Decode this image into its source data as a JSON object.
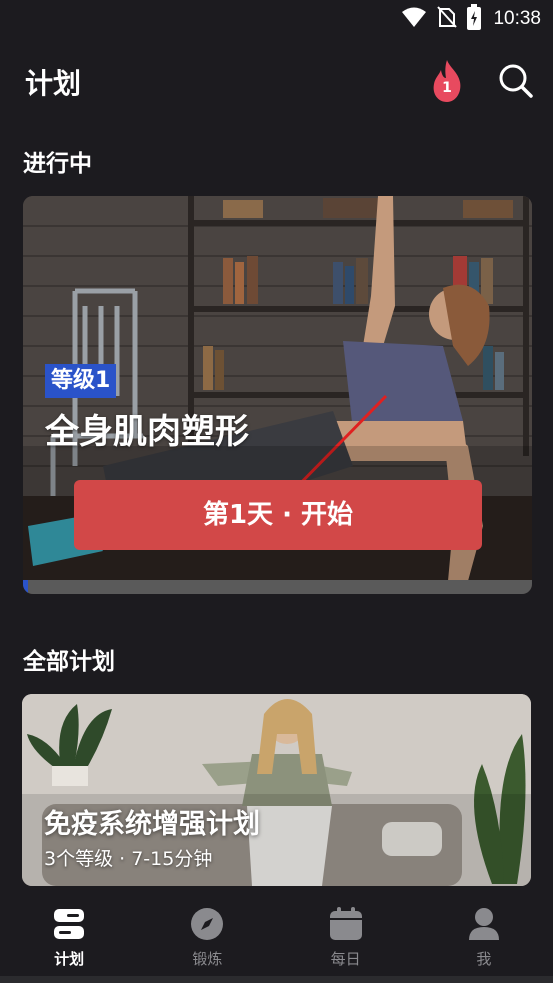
{
  "status_bar": {
    "time": "10:38",
    "icons": [
      "wifi-icon",
      "no-sim-icon",
      "battery-charging-icon"
    ]
  },
  "header": {
    "title": "计划",
    "streak_count": "1",
    "icons": [
      "flame-icon",
      "search-icon"
    ],
    "accent_color": "#e84a5f"
  },
  "in_progress": {
    "section_title": "进行中",
    "level": "等级1",
    "plan_title": "全身肌肉塑形",
    "start_button": "第1天 · 开始",
    "progress": 0.01,
    "button_color": "#d24848",
    "badge_color": "#2a53c9"
  },
  "all_plans": {
    "section_title": "全部计划",
    "plans": [
      {
        "title": "免疫系统增强计划",
        "meta": "3个等级 · 7-15分钟"
      }
    ]
  },
  "bottom_nav": {
    "items": [
      {
        "label": "计划",
        "icon": "plan-icon",
        "active": true
      },
      {
        "label": "锻炼",
        "icon": "compass-icon",
        "active": false
      },
      {
        "label": "每日",
        "icon": "calendar-icon",
        "active": false
      },
      {
        "label": "我",
        "icon": "profile-icon",
        "active": false
      }
    ]
  }
}
